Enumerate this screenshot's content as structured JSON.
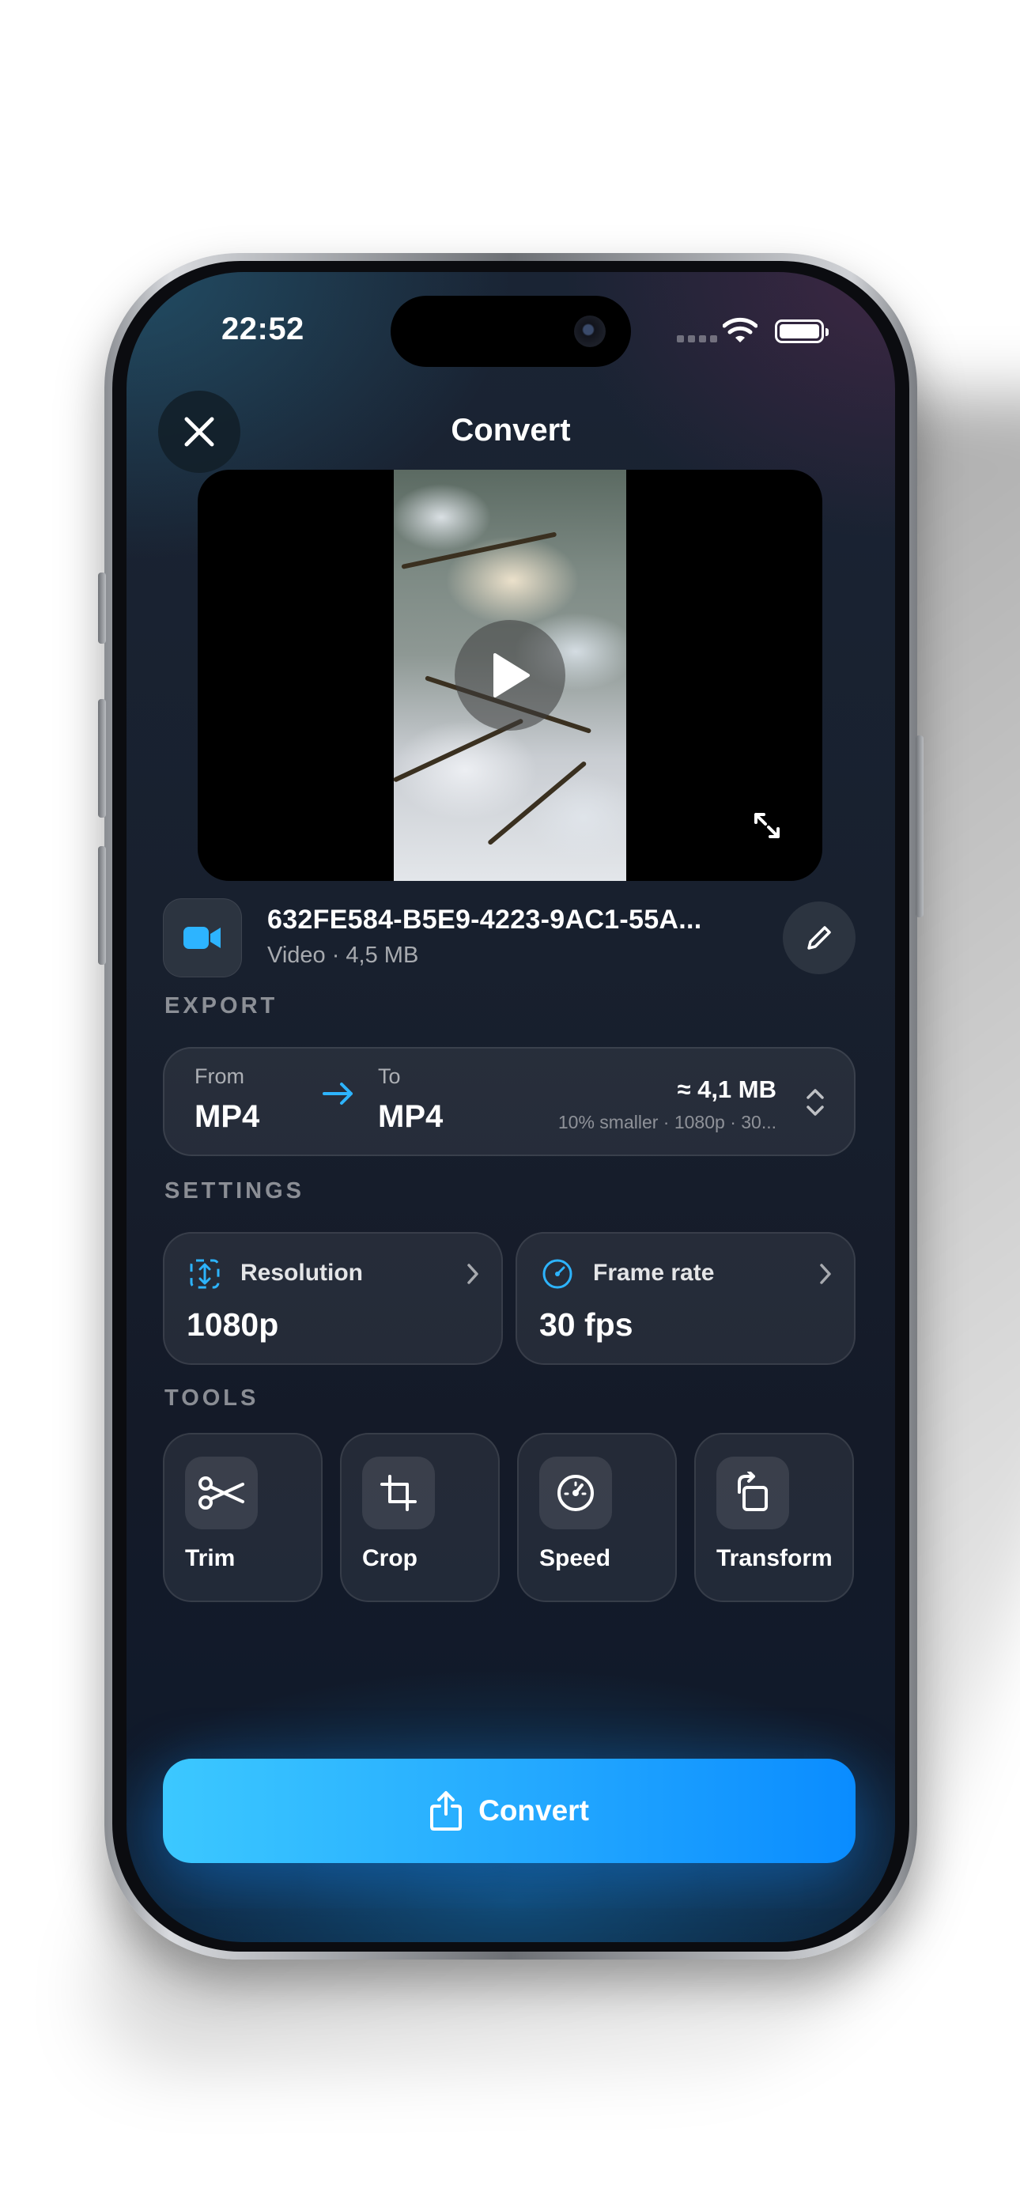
{
  "status": {
    "time": "22:52"
  },
  "header": {
    "title": "Convert"
  },
  "file": {
    "name": "632FE584-B5E9-4223-9AC1-55A...",
    "meta": "Video · 4,5 MB"
  },
  "export": {
    "section_label": "EXPORT",
    "from_label": "From",
    "from_format": "MP4",
    "to_label": "To",
    "to_format": "MP4",
    "estimated_size": "≈ 4,1 MB",
    "details": "10% smaller · 1080p · 30..."
  },
  "settings": {
    "section_label": "SETTINGS",
    "items": [
      {
        "title": "Resolution",
        "value": "1080p",
        "icon": "resolution-icon"
      },
      {
        "title": "Frame rate",
        "value": "30 fps",
        "icon": "speedometer-icon"
      }
    ]
  },
  "tools": {
    "section_label": "TOOLS",
    "items": [
      {
        "label": "Trim",
        "icon": "scissors-icon"
      },
      {
        "label": "Crop",
        "icon": "crop-icon"
      },
      {
        "label": "Speed",
        "icon": "speed-gauge-icon"
      },
      {
        "label": "Transform",
        "icon": "rotate-icon"
      }
    ]
  },
  "action": {
    "convert_label": "Convert"
  },
  "colors": {
    "accent": "#2db4ff",
    "background": "#161e2c",
    "card": "#252c3a"
  }
}
